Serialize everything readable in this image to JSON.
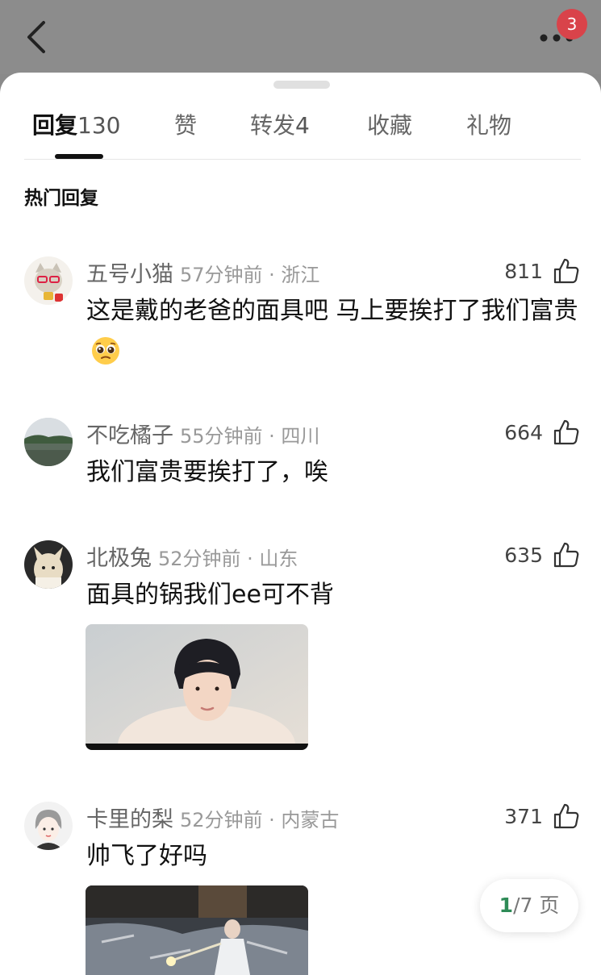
{
  "header": {
    "back_icon": "chevron-left-icon",
    "more_icon": "more-dots-icon",
    "notification_count": "3"
  },
  "tabs": [
    {
      "label": "回复",
      "count": "130"
    },
    {
      "label": "赞",
      "count": ""
    },
    {
      "label": "转发",
      "count": "4"
    },
    {
      "label": "收藏",
      "count": ""
    },
    {
      "label": "礼物",
      "count": ""
    }
  ],
  "section_title": "热门回复",
  "comments": [
    {
      "username": "五号小猫",
      "meta": "57分钟前 · 浙江",
      "likes": "811",
      "text": "这是戴的老爸的面具吧 马上要挨打了我们富贵",
      "emoji": "pleading-face-icon"
    },
    {
      "username": "不吃橘子",
      "meta": "55分钟前 · 四川",
      "likes": "664",
      "text": "我们富贵要挨打了，唉"
    },
    {
      "username": "北极兔",
      "meta": "52分钟前 · 山东",
      "likes": "635",
      "text": "面具的锅我们ee可不背"
    },
    {
      "username": "卡里的梨",
      "meta": "52分钟前 · 内蒙古",
      "likes": "371",
      "text": "帅飞了好吗"
    }
  ],
  "pager": {
    "current": "1",
    "total_text": "/7 页"
  },
  "colors": {
    "badge": "#d9434a",
    "pager_current": "#2e8b57",
    "header_bg": "#8c8c8c"
  }
}
